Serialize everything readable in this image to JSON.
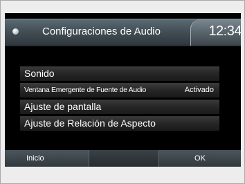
{
  "header": {
    "title": "Configuraciones de Audio",
    "clock": "12:34",
    "home_icon": "home-dot-icon"
  },
  "menu": {
    "items": [
      {
        "label": "Sonido"
      },
      {
        "label": "Ventana Emergente de Fuente de Audio",
        "value": "Activado"
      },
      {
        "label": "Ajuste de pantalla"
      },
      {
        "label": "Ajuste de Relación de Aspecto"
      }
    ]
  },
  "footer": {
    "inicio_label": "Inicio",
    "ok_label": "OK"
  }
}
